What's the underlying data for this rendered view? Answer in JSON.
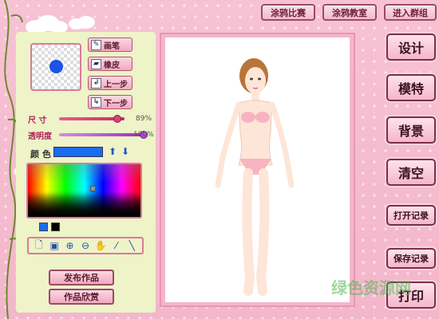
{
  "top_bar": {
    "contest": "涂鸦比赛",
    "classroom": "涂鸦教室",
    "join_group": "进入群组"
  },
  "tools": {
    "brush": "画笔",
    "eraser": "橡皮",
    "undo": "上一步",
    "redo": "下一步"
  },
  "sliders": {
    "size_label": "尺 寸",
    "size_value": "89%",
    "size_level": 0.89,
    "opacity_label": "透明度",
    "opacity_value": "100%",
    "opacity_level": 1.0
  },
  "color": {
    "label": "颜 色",
    "current": "#1a6cf0",
    "recent": [
      "#1a6cf0",
      "#000000"
    ]
  },
  "bottom_buttons": {
    "publish": "发布作品",
    "gallery": "作品欣赏"
  },
  "right_menu": {
    "design": "设计",
    "model": "模特",
    "background": "背景",
    "clear": "清空",
    "open_record": "打开记录",
    "save_record": "保存记录",
    "print": "打印"
  },
  "watermark": "绿色资源网"
}
